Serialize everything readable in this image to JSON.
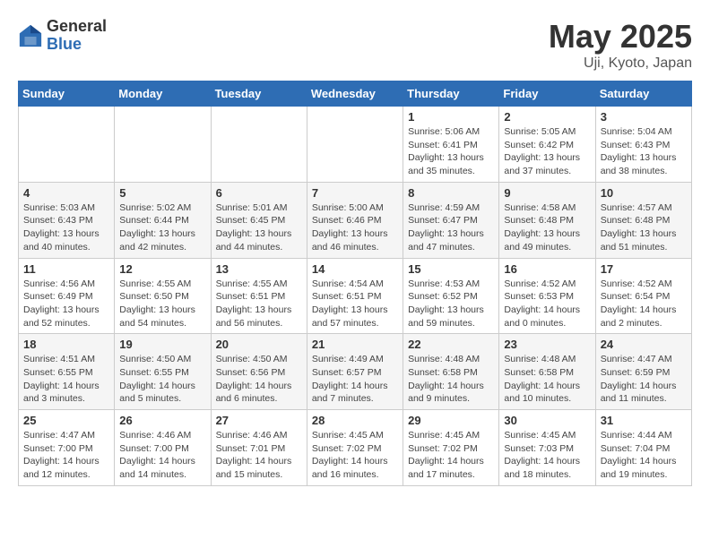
{
  "header": {
    "logo_general": "General",
    "logo_blue": "Blue",
    "month_title": "May 2025",
    "location": "Uji, Kyoto, Japan"
  },
  "days_of_week": [
    "Sunday",
    "Monday",
    "Tuesday",
    "Wednesday",
    "Thursday",
    "Friday",
    "Saturday"
  ],
  "weeks": [
    [
      {
        "day": "",
        "info": ""
      },
      {
        "day": "",
        "info": ""
      },
      {
        "day": "",
        "info": ""
      },
      {
        "day": "",
        "info": ""
      },
      {
        "day": "1",
        "info": "Sunrise: 5:06 AM\nSunset: 6:41 PM\nDaylight: 13 hours\nand 35 minutes."
      },
      {
        "day": "2",
        "info": "Sunrise: 5:05 AM\nSunset: 6:42 PM\nDaylight: 13 hours\nand 37 minutes."
      },
      {
        "day": "3",
        "info": "Sunrise: 5:04 AM\nSunset: 6:43 PM\nDaylight: 13 hours\nand 38 minutes."
      }
    ],
    [
      {
        "day": "4",
        "info": "Sunrise: 5:03 AM\nSunset: 6:43 PM\nDaylight: 13 hours\nand 40 minutes."
      },
      {
        "day": "5",
        "info": "Sunrise: 5:02 AM\nSunset: 6:44 PM\nDaylight: 13 hours\nand 42 minutes."
      },
      {
        "day": "6",
        "info": "Sunrise: 5:01 AM\nSunset: 6:45 PM\nDaylight: 13 hours\nand 44 minutes."
      },
      {
        "day": "7",
        "info": "Sunrise: 5:00 AM\nSunset: 6:46 PM\nDaylight: 13 hours\nand 46 minutes."
      },
      {
        "day": "8",
        "info": "Sunrise: 4:59 AM\nSunset: 6:47 PM\nDaylight: 13 hours\nand 47 minutes."
      },
      {
        "day": "9",
        "info": "Sunrise: 4:58 AM\nSunset: 6:48 PM\nDaylight: 13 hours\nand 49 minutes."
      },
      {
        "day": "10",
        "info": "Sunrise: 4:57 AM\nSunset: 6:48 PM\nDaylight: 13 hours\nand 51 minutes."
      }
    ],
    [
      {
        "day": "11",
        "info": "Sunrise: 4:56 AM\nSunset: 6:49 PM\nDaylight: 13 hours\nand 52 minutes."
      },
      {
        "day": "12",
        "info": "Sunrise: 4:55 AM\nSunset: 6:50 PM\nDaylight: 13 hours\nand 54 minutes."
      },
      {
        "day": "13",
        "info": "Sunrise: 4:55 AM\nSunset: 6:51 PM\nDaylight: 13 hours\nand 56 minutes."
      },
      {
        "day": "14",
        "info": "Sunrise: 4:54 AM\nSunset: 6:51 PM\nDaylight: 13 hours\nand 57 minutes."
      },
      {
        "day": "15",
        "info": "Sunrise: 4:53 AM\nSunset: 6:52 PM\nDaylight: 13 hours\nand 59 minutes."
      },
      {
        "day": "16",
        "info": "Sunrise: 4:52 AM\nSunset: 6:53 PM\nDaylight: 14 hours\nand 0 minutes."
      },
      {
        "day": "17",
        "info": "Sunrise: 4:52 AM\nSunset: 6:54 PM\nDaylight: 14 hours\nand 2 minutes."
      }
    ],
    [
      {
        "day": "18",
        "info": "Sunrise: 4:51 AM\nSunset: 6:55 PM\nDaylight: 14 hours\nand 3 minutes."
      },
      {
        "day": "19",
        "info": "Sunrise: 4:50 AM\nSunset: 6:55 PM\nDaylight: 14 hours\nand 5 minutes."
      },
      {
        "day": "20",
        "info": "Sunrise: 4:50 AM\nSunset: 6:56 PM\nDaylight: 14 hours\nand 6 minutes."
      },
      {
        "day": "21",
        "info": "Sunrise: 4:49 AM\nSunset: 6:57 PM\nDaylight: 14 hours\nand 7 minutes."
      },
      {
        "day": "22",
        "info": "Sunrise: 4:48 AM\nSunset: 6:58 PM\nDaylight: 14 hours\nand 9 minutes."
      },
      {
        "day": "23",
        "info": "Sunrise: 4:48 AM\nSunset: 6:58 PM\nDaylight: 14 hours\nand 10 minutes."
      },
      {
        "day": "24",
        "info": "Sunrise: 4:47 AM\nSunset: 6:59 PM\nDaylight: 14 hours\nand 11 minutes."
      }
    ],
    [
      {
        "day": "25",
        "info": "Sunrise: 4:47 AM\nSunset: 7:00 PM\nDaylight: 14 hours\nand 12 minutes."
      },
      {
        "day": "26",
        "info": "Sunrise: 4:46 AM\nSunset: 7:00 PM\nDaylight: 14 hours\nand 14 minutes."
      },
      {
        "day": "27",
        "info": "Sunrise: 4:46 AM\nSunset: 7:01 PM\nDaylight: 14 hours\nand 15 minutes."
      },
      {
        "day": "28",
        "info": "Sunrise: 4:45 AM\nSunset: 7:02 PM\nDaylight: 14 hours\nand 16 minutes."
      },
      {
        "day": "29",
        "info": "Sunrise: 4:45 AM\nSunset: 7:02 PM\nDaylight: 14 hours\nand 17 minutes."
      },
      {
        "day": "30",
        "info": "Sunrise: 4:45 AM\nSunset: 7:03 PM\nDaylight: 14 hours\nand 18 minutes."
      },
      {
        "day": "31",
        "info": "Sunrise: 4:44 AM\nSunset: 7:04 PM\nDaylight: 14 hours\nand 19 minutes."
      }
    ]
  ]
}
